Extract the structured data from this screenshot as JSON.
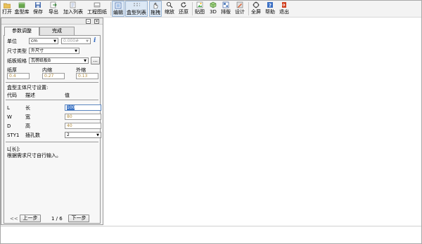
{
  "toolbar": {
    "buttons": [
      {
        "label": "打开",
        "icon": "folder-open-icon"
      },
      {
        "label": "盒型库",
        "icon": "box-library-icon"
      },
      {
        "label": "保存",
        "icon": "save-icon"
      },
      {
        "label": "导出",
        "icon": "export-icon"
      },
      {
        "label": "加入列表",
        "icon": "add-list-icon"
      },
      {
        "label": "工程图纸",
        "icon": "drawing-icon"
      },
      {
        "label": "编辑",
        "icon": "edit-icon"
      },
      {
        "label": "盒型列表",
        "icon": "box-list-icon"
      },
      {
        "label": "拖拽",
        "icon": "hand-icon"
      },
      {
        "label": "缩放",
        "icon": "zoom-icon"
      },
      {
        "label": "还原",
        "icon": "restore-icon"
      },
      {
        "label": "贴图",
        "icon": "texture-icon"
      },
      {
        "label": "3D",
        "icon": "3d-icon"
      },
      {
        "label": "排版",
        "icon": "layout-icon"
      },
      {
        "label": "设计",
        "icon": "design-icon"
      },
      {
        "label": "全屏",
        "icon": "fullscreen-icon"
      },
      {
        "label": "帮助",
        "icon": "help-icon"
      },
      {
        "label": "退出",
        "icon": "exit-icon"
      }
    ]
  },
  "panel": {
    "tabs": [
      "参数调整",
      "完成"
    ],
    "unit_label": "单位",
    "unit_value": "cm",
    "precision_value": "0.000#",
    "size_type_label": "尺寸类型",
    "size_type_value": "外尺寸",
    "paper_spec_label": "纸板规格",
    "paper_spec_value": "瓦楞纸板B",
    "paper_spec_btn": "...",
    "thickness": {
      "labels": [
        "纸厚",
        "内缩",
        "外缩"
      ],
      "values": [
        "0.4",
        "0.27",
        "0.13"
      ]
    },
    "section_title": "盒型主体尺寸设置:",
    "table": {
      "headers": [
        "代码",
        "描述",
        "值"
      ],
      "rows": [
        {
          "code": "L",
          "desc": "长",
          "value": "100"
        },
        {
          "code": "W",
          "desc": "宽",
          "value": "80"
        },
        {
          "code": "D",
          "desc": "高",
          "value": "40"
        },
        {
          "code": "STY1",
          "desc": "插孔数",
          "value": "2"
        }
      ]
    },
    "hint_title": "L[长]:",
    "hint_text": "根据需求尺寸自行输入。",
    "nav": {
      "first": "<<",
      "prev": "上一步",
      "page": "1 / 6",
      "next": "下一步"
    }
  }
}
